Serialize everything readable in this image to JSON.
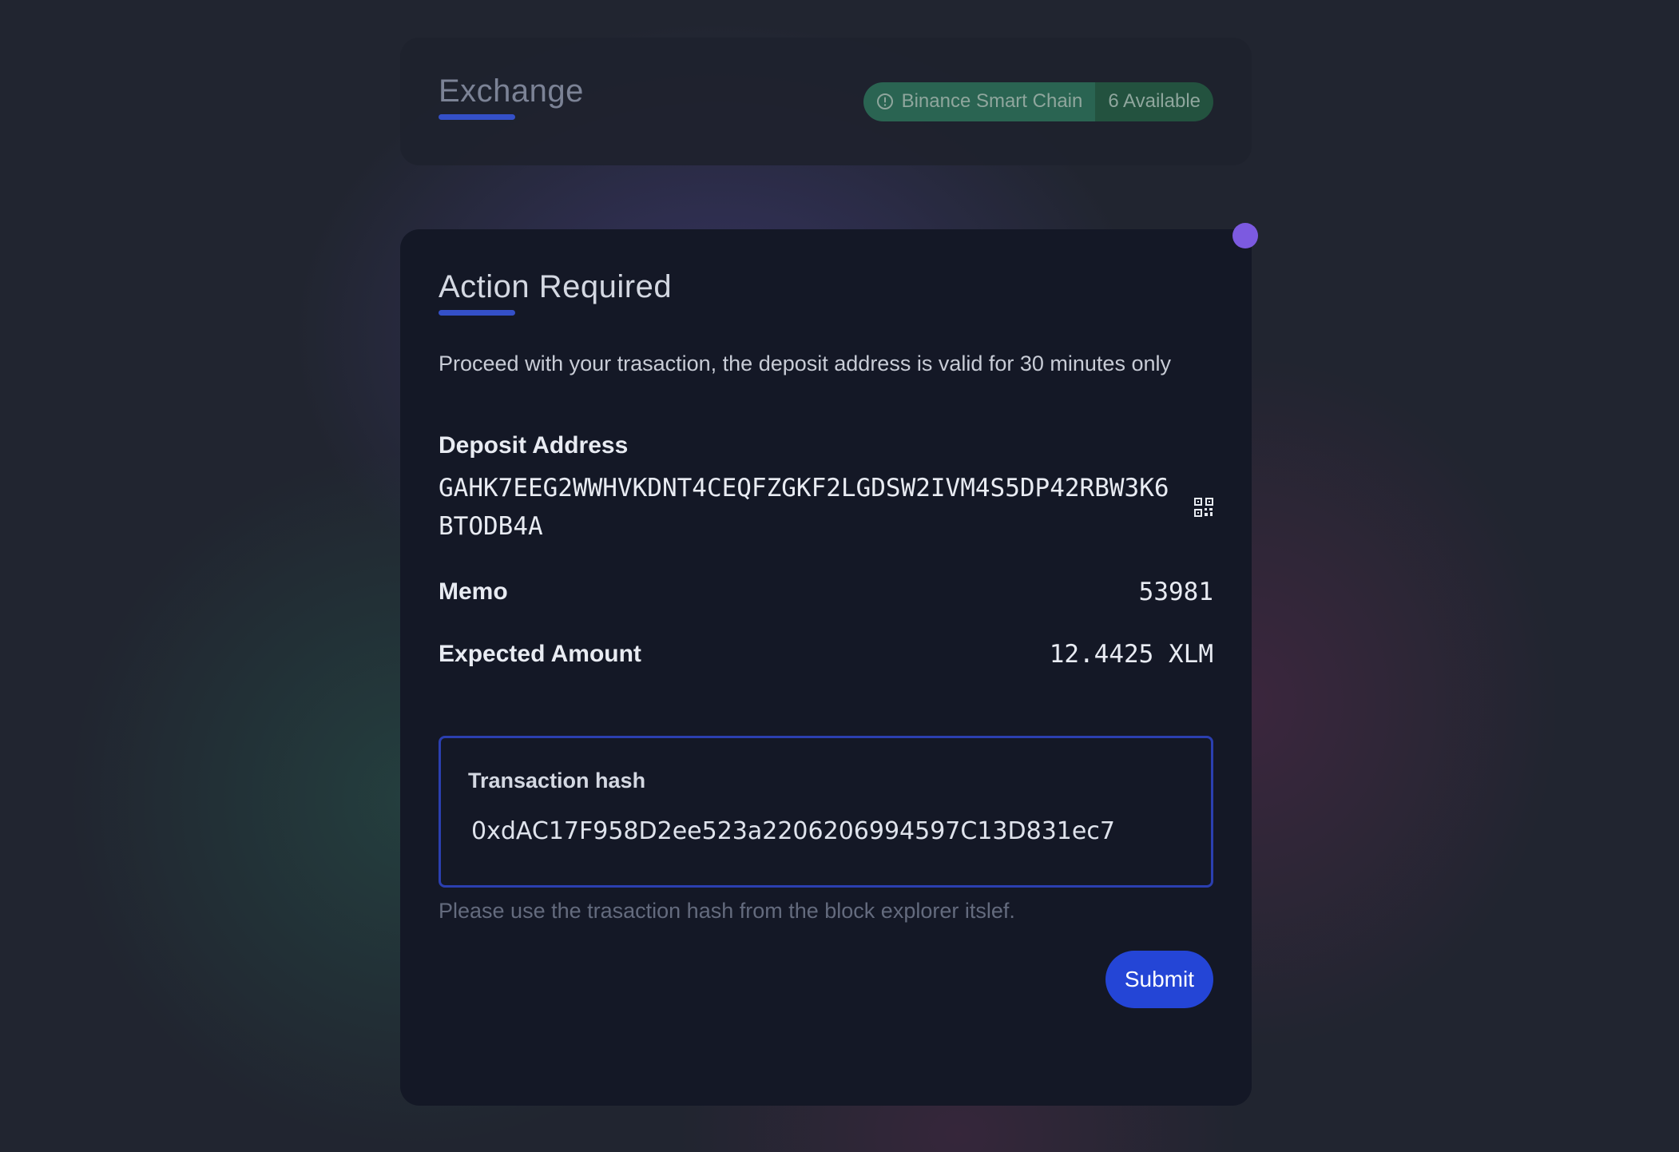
{
  "header": {
    "title": "Exchange",
    "network_name": "Binance Smart Chain",
    "available_label": "6 Available"
  },
  "main": {
    "title": "Action Required",
    "instructions": "Proceed with your trasaction, the deposit address is valid for 30 minutes only",
    "deposit_address": {
      "label": "Deposit Address",
      "value": "GAHK7EEG2WWHVKDNT4CEQFZGKF2LGDSW2IVM4S5DP42RBW3K6BTODB4A"
    },
    "memo": {
      "label": "Memo",
      "value": "53981"
    },
    "expected_amount": {
      "label": "Expected Amount",
      "value": "12.4425 XLM"
    },
    "transaction_hash": {
      "label": "Transaction hash",
      "value": "0xdAC17F958D2ee523a2206206994597C13D831ec7",
      "helper": "Please use the trasaction hash from the block explorer itslef."
    },
    "submit_label": "Submit"
  },
  "icons": {
    "network_badge": "info-circle-icon",
    "address_action": "qr-code-icon"
  },
  "colors": {
    "accent": "#2445d6",
    "underline": "#3450c8",
    "status_dot": "#7c5ae0",
    "network_badge": "#2a6452"
  }
}
